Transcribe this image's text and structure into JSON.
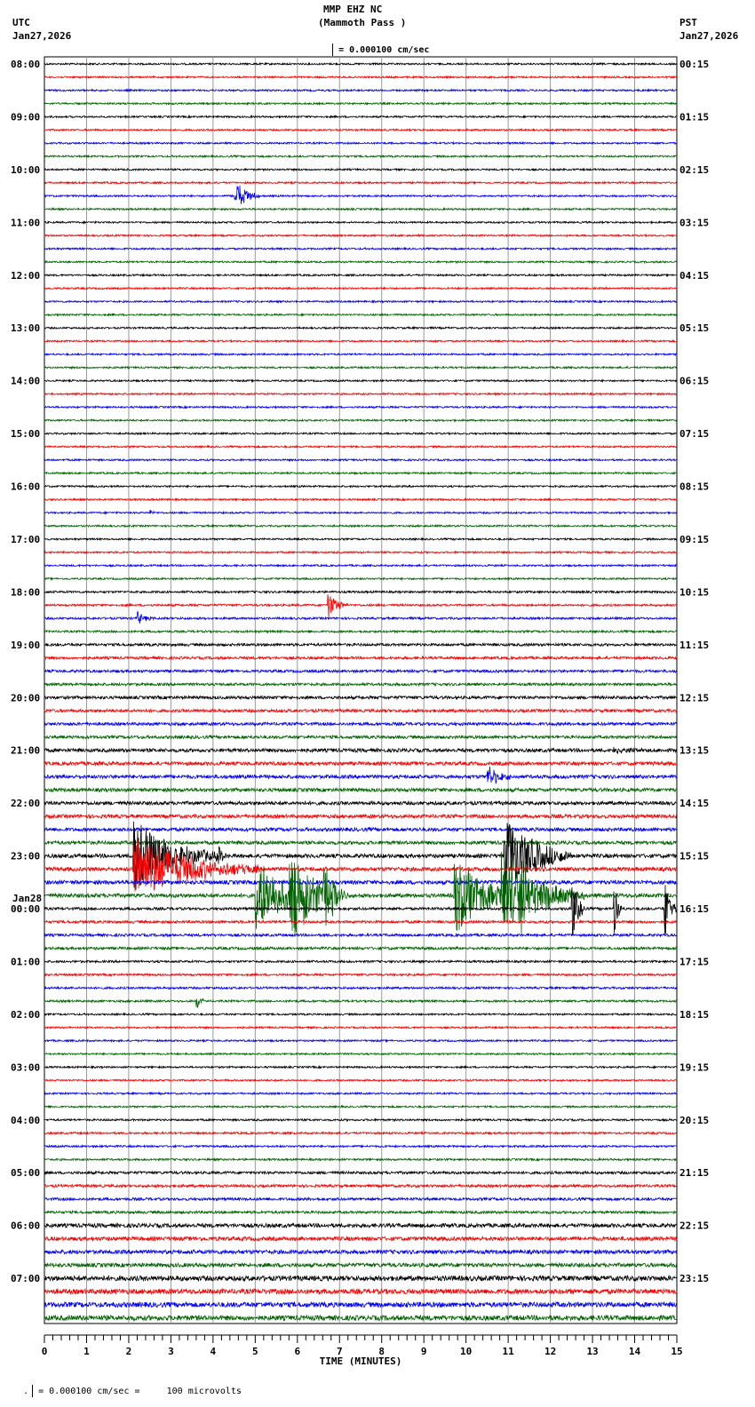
{
  "header": {
    "station": "MMP EHZ NC",
    "location": "(Mammoth Pass )",
    "left_tz": "UTC",
    "left_date": "Jan27,2026",
    "right_tz": "PST",
    "right_date": "Jan27,2026",
    "scale": "= 0.000100 cm/sec"
  },
  "footer": {
    "scale": "= 0.000100 cm/sec =     100 microvolts"
  },
  "chart_data": {
    "type": "line",
    "title": "MMP EHZ NC (Mammoth Pass )",
    "xlabel": "TIME (MINUTES)",
    "xlim": [
      0,
      15
    ],
    "x_ticks": [
      "0",
      "1",
      "2",
      "3",
      "4",
      "5",
      "6",
      "7",
      "8",
      "9",
      "10",
      "11",
      "12",
      "13",
      "14",
      "15"
    ],
    "traces_per_hour": 4,
    "trace_colors": [
      "#000000",
      "#ff0000",
      "#0000ff",
      "#006400"
    ],
    "utc_labels": [
      "08:00",
      "09:00",
      "10:00",
      "11:00",
      "12:00",
      "13:00",
      "14:00",
      "15:00",
      "16:00",
      "17:00",
      "18:00",
      "19:00",
      "20:00",
      "21:00",
      "22:00",
      "23:00",
      "00:00",
      "01:00",
      "02:00",
      "03:00",
      "04:00",
      "05:00",
      "06:00",
      "07:00"
    ],
    "date_change": {
      "label": "Jan28",
      "at": "00:00"
    },
    "pst_labels": [
      "00:15",
      "01:15",
      "02:15",
      "03:15",
      "04:15",
      "05:15",
      "06:15",
      "07:15",
      "08:15",
      "09:15",
      "10:15",
      "11:15",
      "12:15",
      "13:15",
      "14:15",
      "15:15",
      "16:15",
      "17:15",
      "18:15",
      "19:15",
      "20:15",
      "21:15",
      "22:15",
      "23:15"
    ],
    "noise_level_by_hour": [
      1,
      1,
      1,
      1,
      1,
      1,
      1,
      1,
      1,
      1,
      1.2,
      1.5,
      1.7,
      2,
      2,
      2.2,
      1.5,
      1.2,
      1,
      1,
      1.1,
      1.5,
      2.2,
      2.8
    ],
    "events": [
      {
        "trace": 10,
        "minute": 4.5,
        "duration": 0.3,
        "amplitude": 20
      },
      {
        "trace": 34,
        "minute": 2.5,
        "duration": 0.05,
        "amplitude": 6
      },
      {
        "trace": 41,
        "minute": 6.7,
        "duration": 0.25,
        "amplitude": 18
      },
      {
        "trace": 42,
        "minute": 2.2,
        "duration": 0.2,
        "amplitude": 8
      },
      {
        "trace": 52,
        "minute": 13.5,
        "duration": 0.4,
        "amplitude": 5
      },
      {
        "trace": 54,
        "minute": 10.5,
        "duration": 0.3,
        "amplitude": 14
      },
      {
        "trace": 60,
        "minute": 2.1,
        "duration": 1.0,
        "amplitude": 45
      },
      {
        "trace": 61,
        "minute": 2.1,
        "duration": 1.5,
        "amplitude": 40
      },
      {
        "trace": 60,
        "minute": 4.1,
        "duration": 0.1,
        "amplitude": 20
      },
      {
        "trace": 63,
        "minute": 5.0,
        "duration": 0.8,
        "amplitude": 45
      },
      {
        "trace": 63,
        "minute": 5.8,
        "duration": 0.6,
        "amplitude": 60
      },
      {
        "trace": 63,
        "minute": 6.6,
        "duration": 0.3,
        "amplitude": 40
      },
      {
        "trace": 63,
        "minute": 9.7,
        "duration": 0.9,
        "amplitude": 45
      },
      {
        "trace": 63,
        "minute": 10.8,
        "duration": 1.0,
        "amplitude": 50
      },
      {
        "trace": 63,
        "minute": 11.3,
        "duration": 0.3,
        "amplitude": 40
      },
      {
        "trace": 60,
        "minute": 10.9,
        "duration": 0.8,
        "amplitude": 50
      },
      {
        "trace": 64,
        "minute": 12.5,
        "duration": 0.15,
        "amplitude": 45
      },
      {
        "trace": 64,
        "minute": 13.5,
        "duration": 0.1,
        "amplitude": 40
      },
      {
        "trace": 64,
        "minute": 14.7,
        "duration": 0.15,
        "amplitude": 45
      },
      {
        "trace": 71,
        "minute": 3.6,
        "duration": 0.1,
        "amplitude": 12
      }
    ]
  }
}
